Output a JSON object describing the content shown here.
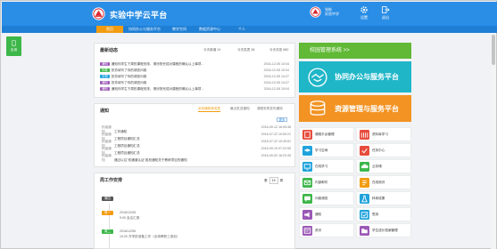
{
  "header": {
    "brand": "实验中学云平台",
    "user_line1": "张彬",
    "user_line2": "实验中学",
    "settings_label": "设置",
    "logout_label": "退出",
    "bg_color": "#2a8ee6"
  },
  "nav": {
    "items": [
      {
        "label": "首页"
      },
      {
        "label": "协同办公与服务平台"
      },
      {
        "label": "教学空间"
      },
      {
        "label": "数据资源中心"
      },
      {
        "label": "个人"
      }
    ]
  },
  "sidebar": {
    "tab_label": "应用"
  },
  "news": {
    "title": "最新动态",
    "stat1": "今天新增 24",
    "stat2": "今天发表 38",
    "stat3": "今天浏览 880",
    "items": [
      {
        "tag": "通知",
        "text": "通知你学生下周的课程安排，请尽快完成对课程的确认以上事项...",
        "date": "2016-12-05 10:04"
      },
      {
        "tag": "问卷",
        "text": "张芳填写了你的调查问卷",
        "date": "2016-12-05 10:04"
      },
      {
        "tag": "文档",
        "text": "张芳填写了你的调查问卷",
        "date": "2016-12-05 14:27"
      },
      {
        "tag": "通知",
        "text": "张芳填写了你的调查问卷",
        "date": "2016-12-05 14:27"
      },
      {
        "tag": "通知",
        "text": "通知你学生下周的课程安排，请尽快完成对课程的确认以上事项...",
        "date": "2016-12-05 10:04"
      }
    ]
  },
  "notice": {
    "title": "通知",
    "tabs": [
      {
        "label": "全校通知新发表"
      },
      {
        "label": "最近发送通知"
      },
      {
        "label": "课程安排发布通知"
      }
    ],
    "more_label": "更多",
    "rows": [
      {
        "cat": "校级通知",
        "text": "工作通知",
        "date": "2016-09-12 16:05:38"
      },
      {
        "cat": "校级通知",
        "text": "工程项目通知汇总",
        "date": "2016-07-22 10:50:21"
      },
      {
        "cat": "校级通知",
        "text": "工程项目通知汇总",
        "date": "2016-07-22 10:49:51"
      },
      {
        "cat": "校级通知",
        "text": "工程项目通知汇总",
        "date": "2016-09-19 07:22:55"
      },
      {
        "cat": "校级通知",
        "text": "通过以往\"双通道认证\"各校通知关于教研项目的通知",
        "date": "2016-09-02 16:23:45"
      }
    ]
  },
  "week": {
    "title": "周工作安排",
    "prefix": "第",
    "week_no": "15",
    "suffix": "周",
    "today_badge": "周四",
    "entries": [
      {
        "badge": "周一",
        "time": "2016/12/05",
        "text": "9:00 会议汇报"
      },
      {
        "badge": "周二",
        "time": "2016/12/06",
        "text": "10:20 开学前准备工作（全体教职工参加）"
      }
    ]
  },
  "banners": {
    "green": "校园管理系统 >>",
    "cyan": "协同办公与服务平台",
    "orange": "资源管理与服务平台"
  },
  "apps": [
    {
      "label": "课程平台管理",
      "color": "#e74c3c"
    },
    {
      "label": "资料库学习",
      "color": "#e74c3c"
    },
    {
      "label": "学习空间",
      "color": "#1fa3dc"
    },
    {
      "label": "任务中心",
      "color": "#e74c3c"
    },
    {
      "label": "在线学习",
      "color": "#1fa3dc"
    },
    {
      "label": "云存储",
      "color": "#3db74a"
    },
    {
      "label": "内部邮件",
      "color": "#3db74a"
    },
    {
      "label": "在线测评",
      "color": "#f39c12"
    },
    {
      "label": "问卷调查",
      "color": "#3db74a"
    },
    {
      "label": "科研成果",
      "color": "#1fa3dc"
    },
    {
      "label": "通知",
      "color": "#9b59b6"
    },
    {
      "label": "签到",
      "color": "#1fa3dc"
    },
    {
      "label": "资讯",
      "color": "#9b59b6"
    },
    {
      "label": "学生成长档案管理",
      "color": "#9b59b6"
    }
  ]
}
